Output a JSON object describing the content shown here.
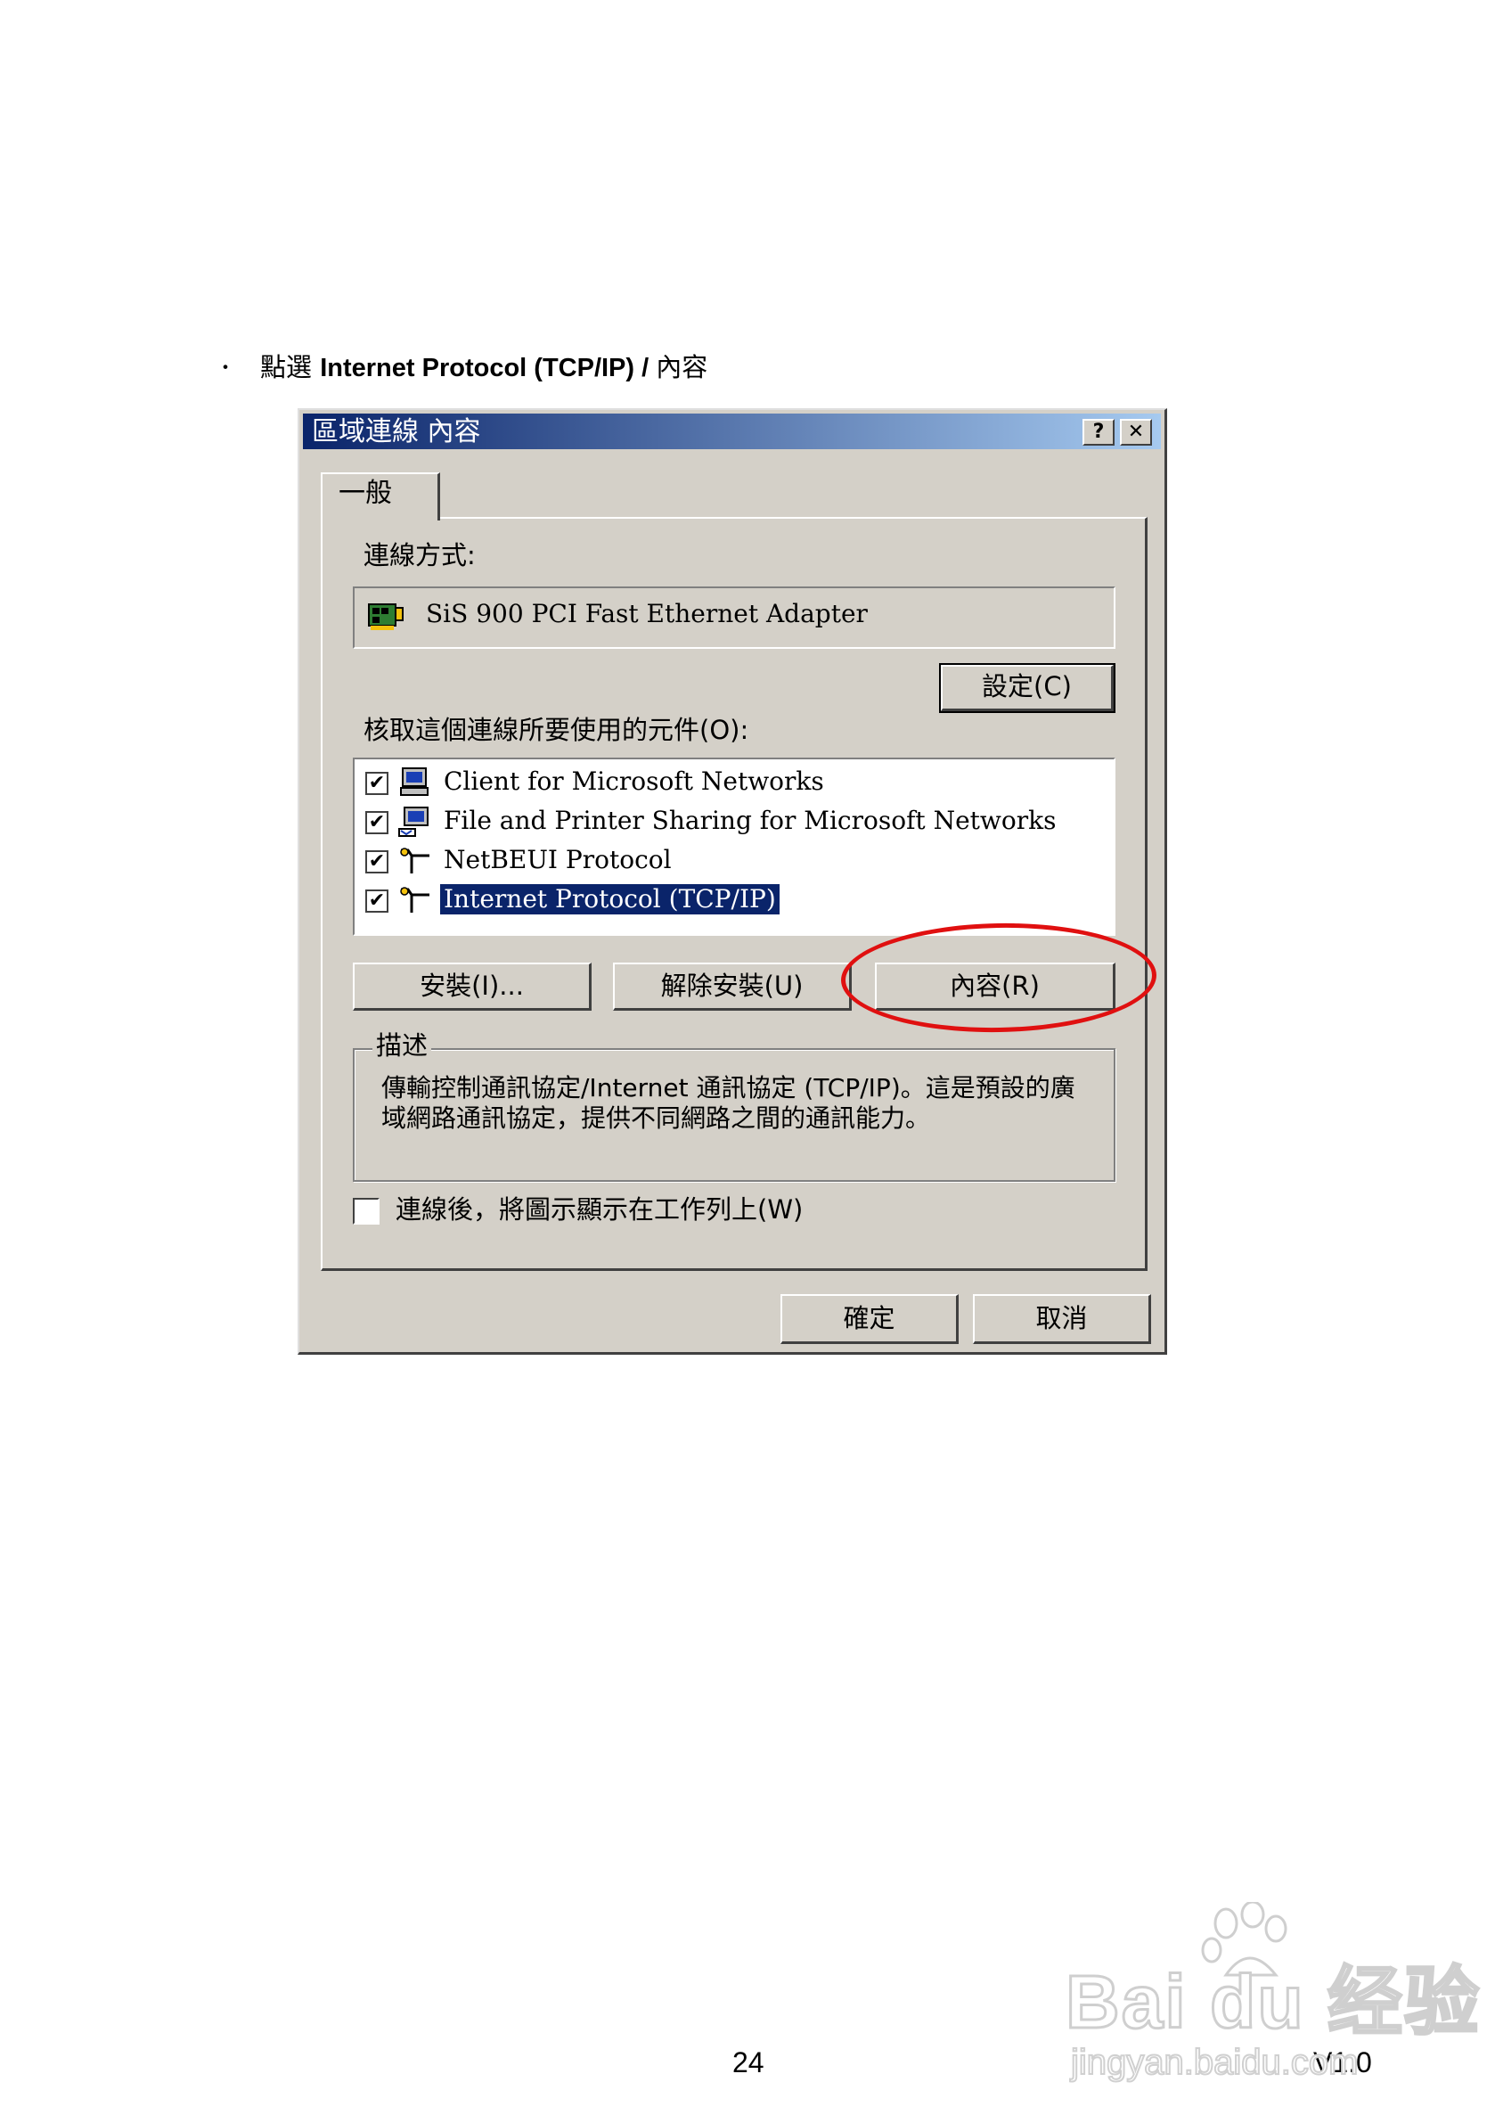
{
  "instruction": {
    "bullet": "・",
    "prefix": "點選 ",
    "bold": "Internet Protocol (TCP/IP) / ",
    "suffix": "內容"
  },
  "dialog": {
    "title": "區域連線 內容",
    "help_button": "?",
    "close_button": "✕",
    "tab": "一般",
    "connect_using_label": "連線方式:",
    "adapter": "SiS 900 PCI Fast Ethernet Adapter",
    "configure_button": "設定(C)",
    "components_label": "核取這個連線所要使用的元件(O):",
    "components": [
      {
        "label": "Client for Microsoft Networks",
        "checked": true,
        "icon": "network-client-icon"
      },
      {
        "label": "File and Printer Sharing for Microsoft Networks",
        "checked": true,
        "icon": "file-printer-sharing-icon"
      },
      {
        "label": "NetBEUI Protocol",
        "checked": true,
        "icon": "protocol-icon"
      },
      {
        "label": "Internet Protocol (TCP/IP)",
        "checked": true,
        "icon": "protocol-icon",
        "selected": true
      }
    ],
    "install_button": "安裝(I)...",
    "uninstall_button": "解除安裝(U)",
    "properties_button": "內容(R)",
    "description_legend": "描述",
    "description": "傳輸控制通訊協定/Internet 通訊協定 (TCP/IP)。這是預設的廣域網路通訊協定，提供不同網路之間的通訊能力。",
    "show_icon_checkbox": {
      "label": "連線後，將圖示顯示在工作列上(W)",
      "checked": false
    },
    "ok_button": "確定",
    "cancel_button": "取消"
  },
  "annotation": {
    "highlight_color": "#e01010",
    "target": "properties_button"
  },
  "page_number": "24",
  "version": "V1.0",
  "watermark": {
    "brand": "Bai du 经验",
    "url": "jingyan.baidu.com"
  },
  "colors": {
    "titlebar_start": "#0a246a",
    "titlebar_end": "#a6caf0",
    "dialog_bg": "#d4d0c8",
    "selection": "#0a246a"
  }
}
